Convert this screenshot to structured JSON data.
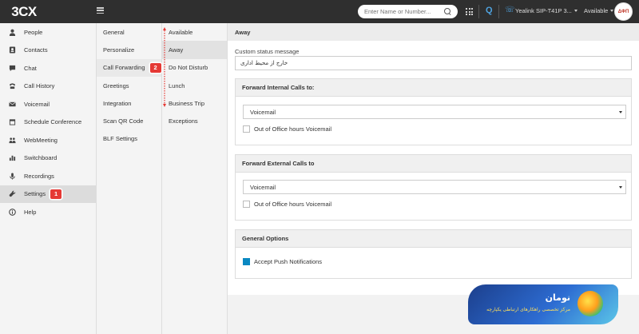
{
  "topbar": {
    "logo": "3CX",
    "search_placeholder": "Enter Name or Number...",
    "phone_label": "Yealink SIP-T41P 3...",
    "status_label": "Available",
    "avatar_text": "ΔΦΠ"
  },
  "sidebar": {
    "items": [
      {
        "label": "People",
        "icon": "person-icon"
      },
      {
        "label": "Contacts",
        "icon": "contacts-icon"
      },
      {
        "label": "Chat",
        "icon": "chat-icon"
      },
      {
        "label": "Call History",
        "icon": "phone-icon"
      },
      {
        "label": "Voicemail",
        "icon": "voicemail-icon"
      },
      {
        "label": "Schedule Conference",
        "icon": "calendar-icon"
      },
      {
        "label": "WebMeeting",
        "icon": "webmeeting-icon"
      },
      {
        "label": "Switchboard",
        "icon": "switchboard-icon"
      },
      {
        "label": "Recordings",
        "icon": "microphone-icon"
      },
      {
        "label": "Settings",
        "icon": "wrench-icon",
        "badge": "1"
      },
      {
        "label": "Help",
        "icon": "info-icon"
      }
    ]
  },
  "settings_menu": {
    "items": [
      {
        "label": "General"
      },
      {
        "label": "Personalize"
      },
      {
        "label": "Call Forwarding",
        "badge": "2"
      },
      {
        "label": "Greetings"
      },
      {
        "label": "Integration"
      },
      {
        "label": "Scan QR Code"
      },
      {
        "label": "BLF Settings"
      }
    ]
  },
  "status_menu": {
    "items": [
      {
        "label": "Available"
      },
      {
        "label": "Away"
      },
      {
        "label": "Do Not Disturb"
      },
      {
        "label": "Lunch"
      },
      {
        "label": "Business Trip"
      },
      {
        "label": "Exceptions"
      }
    ]
  },
  "main": {
    "title": "Away",
    "custom_status_label": "Custom status message",
    "custom_status_value": "خارج از محیط اداری",
    "internal": {
      "title": "Forward Internal Calls to:",
      "select_value": "Voicemail",
      "checkbox_label": "Out of Office hours Voicemail"
    },
    "external": {
      "title": "Forward External Calls to",
      "select_value": "Voicemail",
      "checkbox_label": "Out of Office hours Voicemail"
    },
    "general": {
      "title": "General Options",
      "checkbox_label": "Accept Push Notifications",
      "checked": true
    }
  },
  "watermark": {
    "title": "نومان",
    "subtitle": "مرکز تخصصی راهکارهای ارتباطی یکپارچه"
  },
  "colors": {
    "topbar": "#2f2f2f",
    "accent": "#4fa3e0",
    "badge": "#e53935",
    "checkbox_on": "#0a88c2"
  }
}
